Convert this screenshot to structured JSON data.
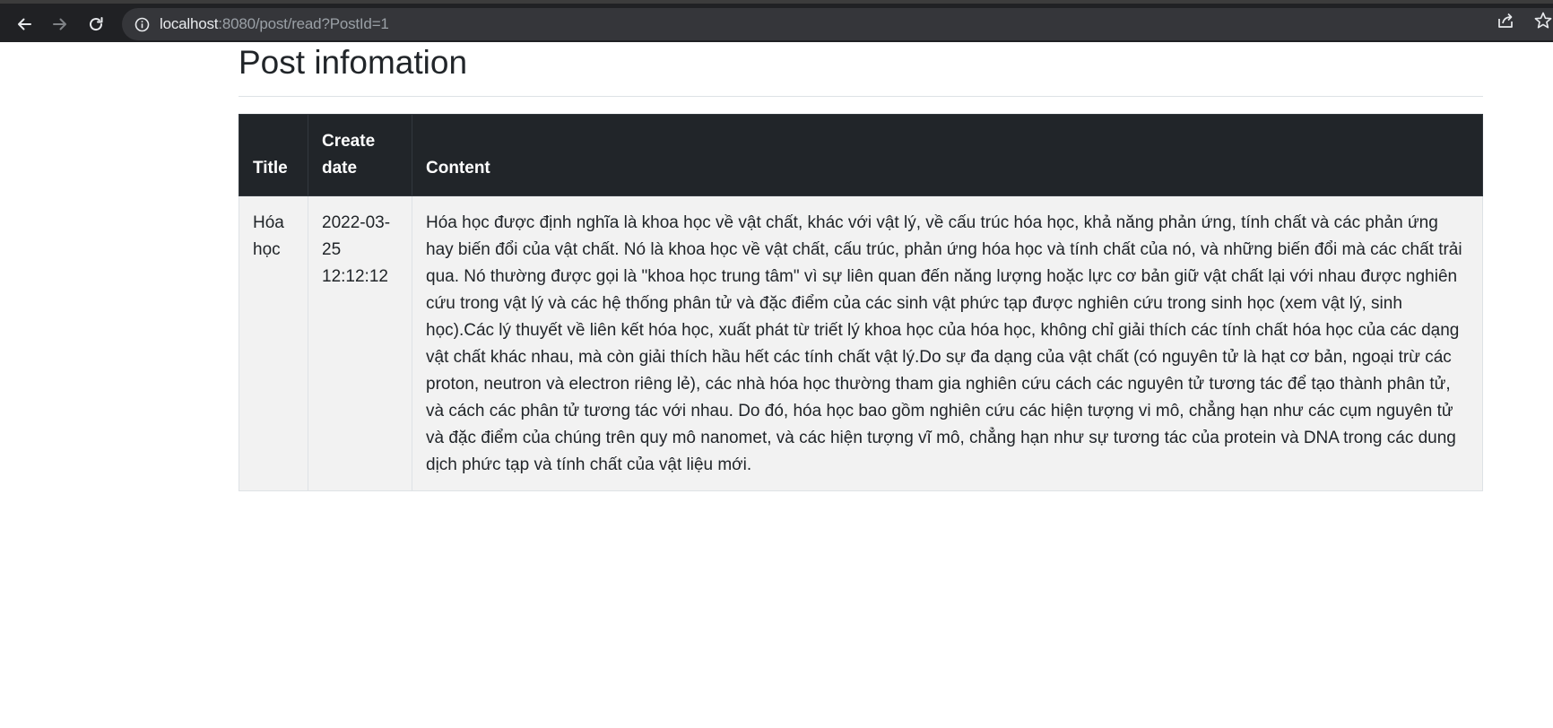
{
  "browser": {
    "url_host": "localhost",
    "url_rest": ":8080/post/read?PostId=1"
  },
  "page": {
    "title": "Post infomation"
  },
  "table": {
    "headers": {
      "title": "Title",
      "create_date": "Create date",
      "content": "Content"
    },
    "rows": [
      {
        "title": "Hóa học",
        "create_date": "2022-03-25 12:12:12",
        "content": "Hóa học được định nghĩa là khoa học về vật chất, khác với vật lý, về cấu trúc hóa học, khả năng phản ứng, tính chất và các phản ứng hay biến đổi của vật chất. Nó là khoa học về vật chất, cấu trúc, phản ứng hóa học và tính chất của nó, và những biến đổi mà các chất trải qua. Nó thường được gọi là \"khoa học trung tâm\" vì sự liên quan đến năng lượng hoặc lực cơ bản giữ vật chất lại với nhau được nghiên cứu trong vật lý và các hệ thống phân tử và đặc điểm của các sinh vật phức tạp được nghiên cứu trong sinh học (xem vật lý, sinh học).Các lý thuyết về liên kết hóa học, xuất phát từ triết lý khoa học của hóa học, không chỉ giải thích các tính chất hóa học của các dạng vật chất khác nhau, mà còn giải thích hầu hết các tính chất vật lý.Do sự đa dạng của vật chất (có nguyên tử là hạt cơ bản, ngoại trừ các proton, neutron và electron riêng lẻ), các nhà hóa học thường tham gia nghiên cứu cách các nguyên tử tương tác để tạo thành phân tử, và cách các phân tử tương tác với nhau. Do đó, hóa học bao gồm nghiên cứu các hiện tượng vi mô, chẳng hạn như các cụm nguyên tử và đặc điểm của chúng trên quy mô nanomet, và các hiện tượng vĩ mô, chẳng hạn như sự tương tác của protein và DNA trong các dung dịch phức tạp và tính chất của vật liệu mới."
      }
    ]
  }
}
